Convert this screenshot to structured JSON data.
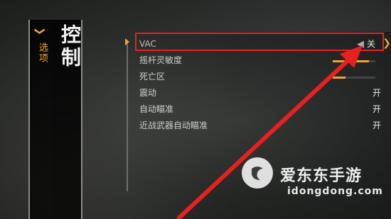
{
  "sidebar": {
    "back_label": "选项",
    "title": "控制"
  },
  "settings": {
    "rows": [
      {
        "name": "VAC",
        "value": "关",
        "selected": true
      },
      {
        "name": "摇杆灵敏度",
        "slider": 0.85
      },
      {
        "name": "死亡区",
        "slider": 0.3
      },
      {
        "name": "震动",
        "value": "开"
      },
      {
        "name": "自动瞄准",
        "value": "开"
      },
      {
        "name": "近战武器自动瞄准",
        "value": "开"
      }
    ]
  },
  "watermark": {
    "brand_cn": "爱东东手游",
    "brand_en": "idongdong.com"
  },
  "colors": {
    "accent": "#f0a52a",
    "annotation": "#e82020"
  }
}
